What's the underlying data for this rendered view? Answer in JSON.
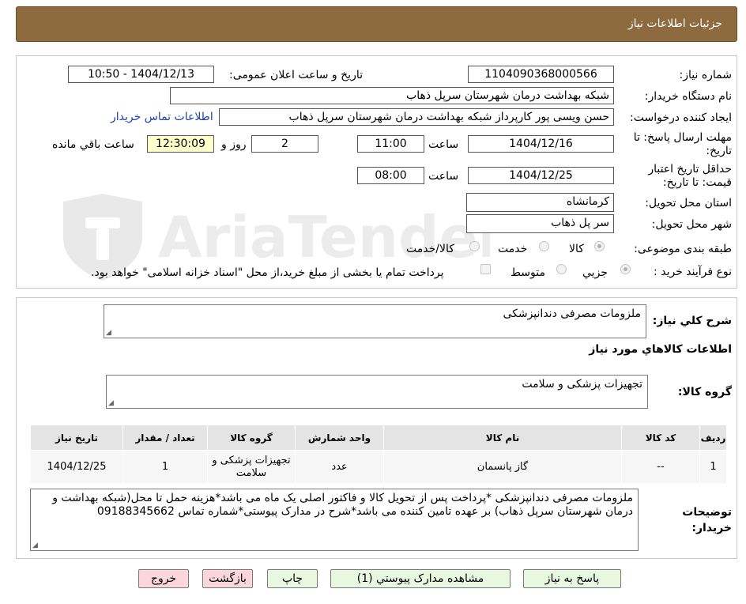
{
  "header": {
    "title": "جزئیات اطلاعات نیاز"
  },
  "form": {
    "need_number_label": "شماره نیاز:",
    "need_number": "1104090368000566",
    "announce_label": "تاریخ و ساعت اعلان عمومی:",
    "announce_value": "1404/12/13 - 10:50",
    "buyer_org_label": "نام دستگاه خریدار:",
    "buyer_org": "شبکه بهداشت درمان شهرستان سرپل ذهاب",
    "requester_label": "ایجاد کننده درخواست:",
    "requester": "حسن ویسی پور کارپرداز شبکه بهداشت درمان شهرستان سرپل ذهاب",
    "contact_link": "اطلاعات تماس خریدار",
    "deadline_label": "مهلت ارسال پاسخ: تا تاریخ:",
    "deadline_date": "1404/12/16",
    "time_label": "ساعت",
    "deadline_time": "11:00",
    "days_value": "2",
    "days_label": "روز و",
    "remaining_time": "12:30:09",
    "remaining_label": "ساعت باقي مانده",
    "validity_label": "حداقل تاریخ اعتبار قیمت: تا تاریخ:",
    "validity_date": "1404/12/25",
    "validity_time": "08:00",
    "province_label": "استان محل تحویل:",
    "province": "کرمانشاه",
    "city_label": "شهر محل تحویل:",
    "city": "سر پل ذهاب",
    "category_label": "طبقه بندی موضوعی:",
    "category_options": [
      "کالا",
      "خدمت",
      "کالا/خدمت"
    ],
    "process_label": "نوع فرآیند خرید :",
    "process_options": [
      "جزیي",
      "متوسط"
    ],
    "payment_note": "پرداخت تمام یا بخشی از مبلغ خرید،از محل \"اسناد خزانه اسلامی\" خواهد بود."
  },
  "summary": {
    "label": "شرح كلي نياز:",
    "value": "ملزومات مصرفی دندانپزشکی"
  },
  "goods_section_title": "اطلاعات كالاهاي مورد نياز",
  "goods_group": {
    "label": "گروه کالا:",
    "value": "تجهیزات پزشکی و سلامت"
  },
  "table": {
    "headers": [
      "رديف",
      "کد کالا",
      "نام کالا",
      "واحد شمارش",
      "گروه کالا",
      "تعداد / مقدار",
      "تاریخ نیاز"
    ],
    "rows": [
      [
        "1",
        "--",
        "گاز پانسمان",
        "عدد",
        "تجهیزات پزشکی و سلامت",
        "1",
        "1404/12/25"
      ]
    ]
  },
  "buyer_notes": {
    "label": "توضیحات خریدار:",
    "value": "ملزومات مصرفی دندانپزشکی *پرداخت پس از تحویل کالا و فاکتور اصلی یک ماه می باشد*هزینه حمل تا محل(شبکه بهداشت و درمان شهرستان سرپل ذهاب) بر عهده تامین کننده می باشد*شرح در مدارک پیوستی*شماره تماس 09188345662"
  },
  "buttons": {
    "reply": "پاسخ به نیاز",
    "attachments": "مشاهده مدارک پیوستي (1)",
    "print": "چاپ",
    "back": "بازگشت",
    "exit": "خروج"
  },
  "colors": {
    "header": "#8e6a3f",
    "button_green": "#e8f8e0",
    "button_pink": "#fcd6dd"
  }
}
